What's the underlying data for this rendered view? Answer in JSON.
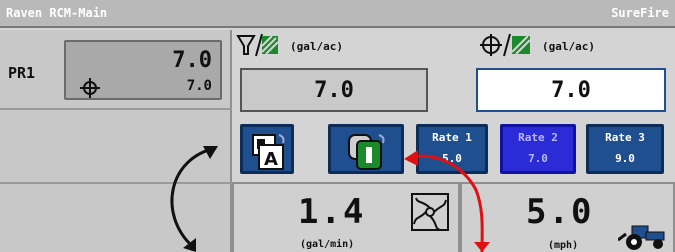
{
  "titlebar": {
    "left": "Raven RCM-Main",
    "right": "SureFire"
  },
  "product": {
    "label": "PR1",
    "rate": "7.0",
    "actual": "7.0"
  },
  "targets": {
    "left_unit": "(gal/ac)",
    "right_unit": "(gal/ac)",
    "left_value": "7.0",
    "right_value": "7.0"
  },
  "rate_buttons": [
    {
      "label": "Rate 1",
      "value": "5.0"
    },
    {
      "label": "Rate 2",
      "value": "7.0",
      "selected": true
    },
    {
      "label": "Rate 3",
      "value": "9.0"
    }
  ],
  "mode_buttons": {
    "auto_letter": "A",
    "manual_icon": "manual-rate-icon"
  },
  "flow": {
    "value": "1.4",
    "unit": "(gal/min)"
  },
  "speed": {
    "value": "5.0",
    "unit": "(mph)"
  },
  "colors": {
    "titlebar": "#b9b9b9",
    "button_blue": "#1f4f8f",
    "selected_rate": "#2b2bd8",
    "arrow_red": "#e01010",
    "green": "#1a8a2a"
  },
  "icons": {
    "product_icon": "crosshair-icon",
    "left_target_icon": "funnel-hatch-icon",
    "right_target_icon": "crosshair-hatch-icon",
    "flow_icon": "turbine-icon",
    "speed_icon": "tractor-icon"
  }
}
